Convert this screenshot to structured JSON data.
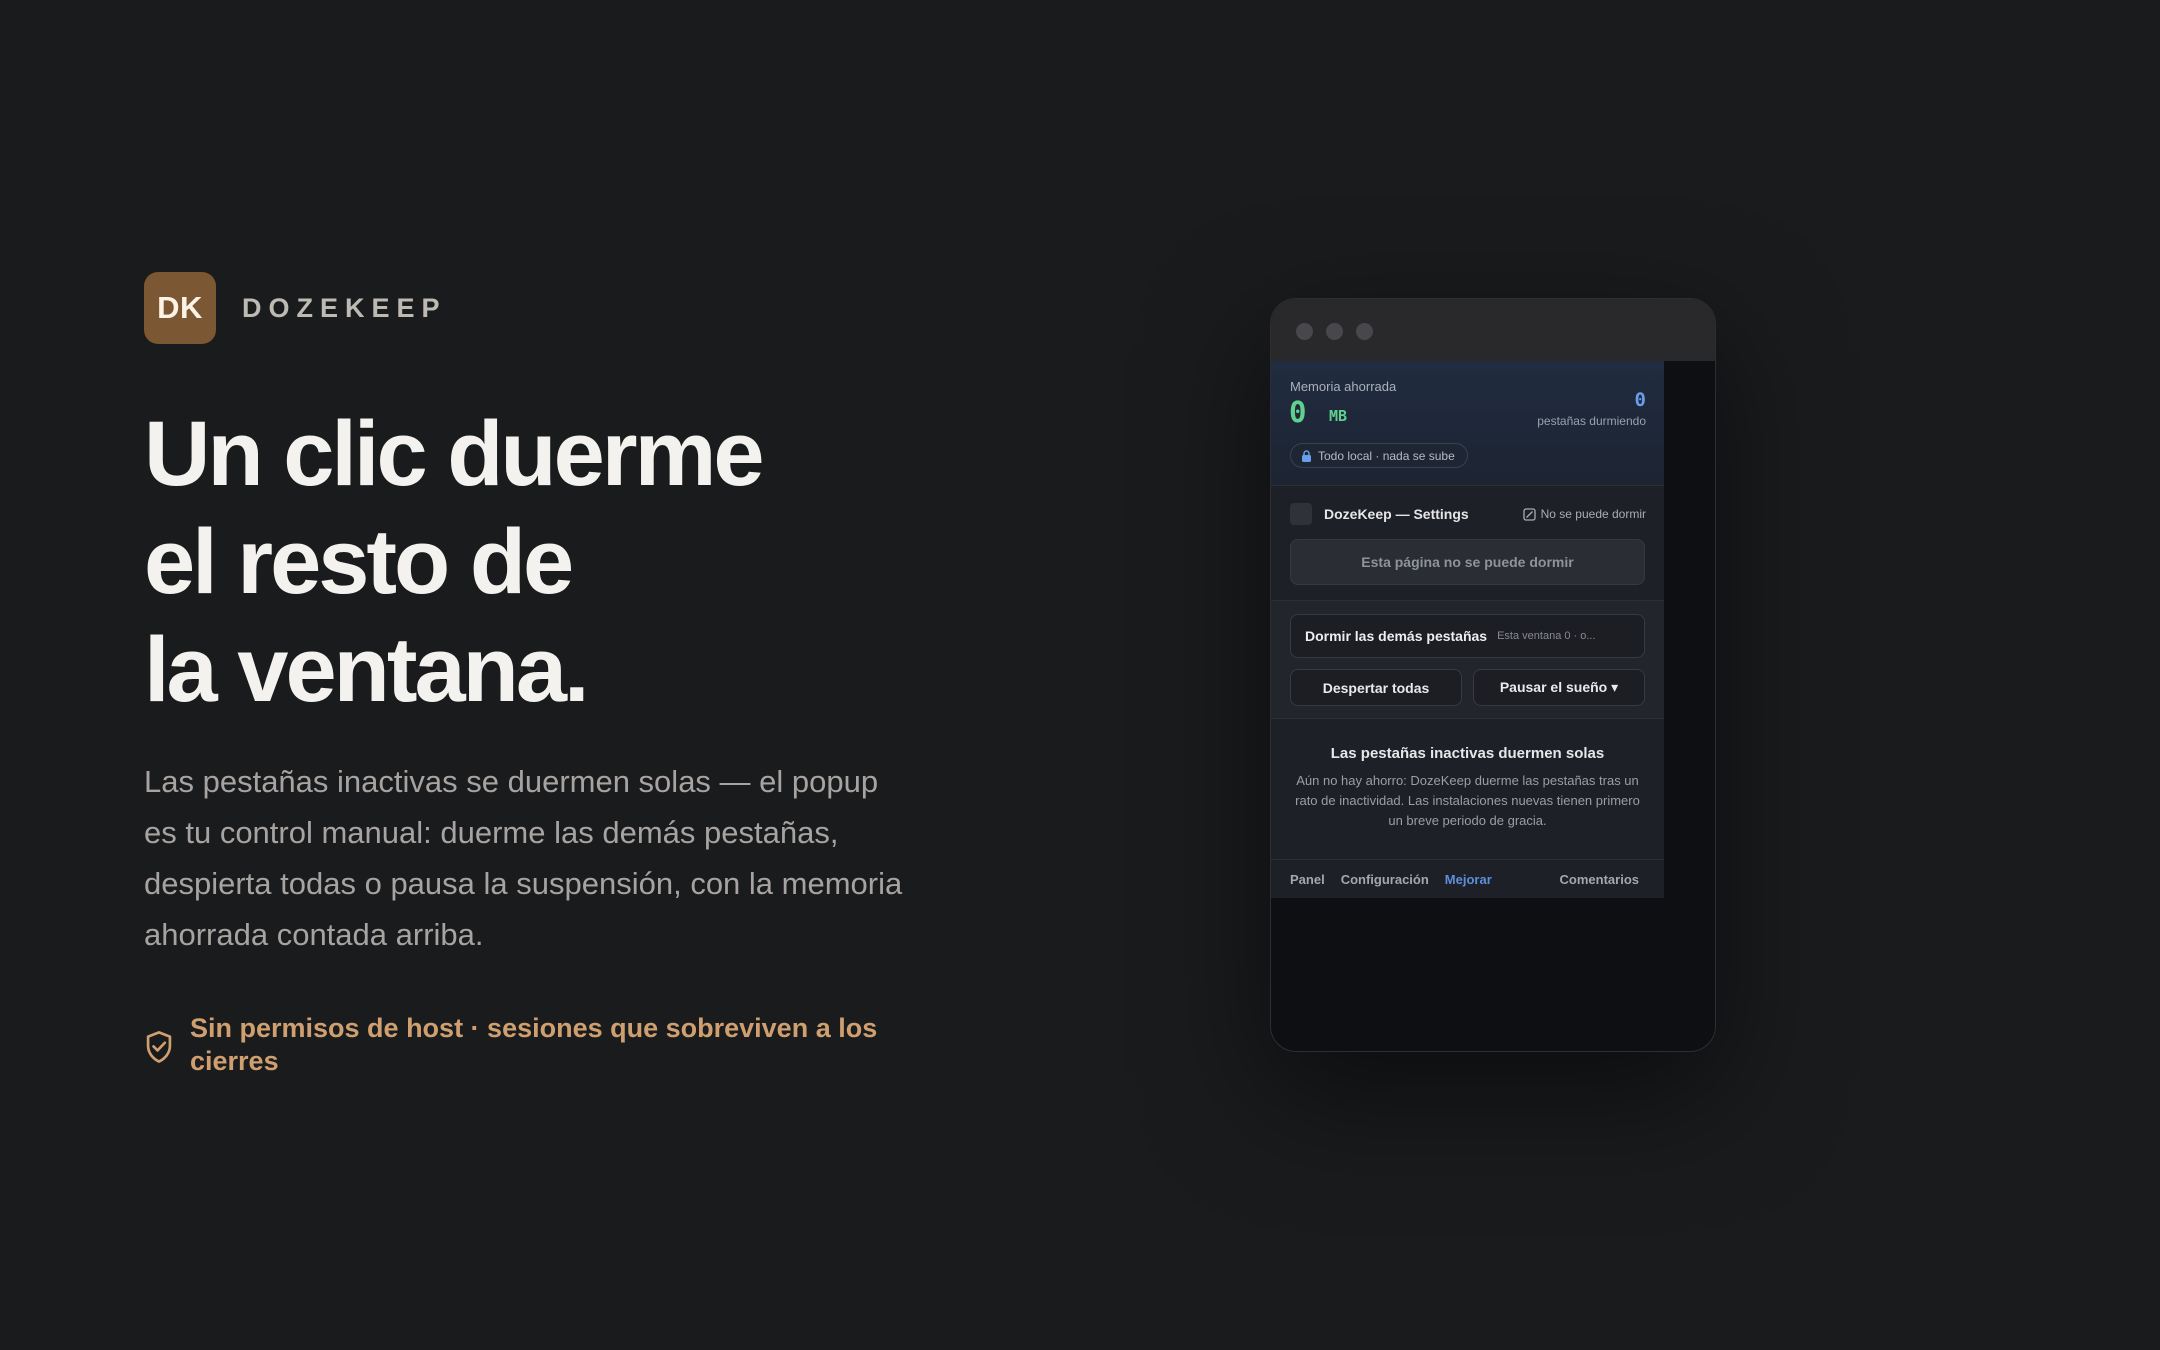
{
  "brand": {
    "logo_text": "DK",
    "name": "DOZEKEEP"
  },
  "hero": {
    "headline": [
      "Un clic duerme",
      "el resto de",
      "la ventana."
    ],
    "lede": "Las pestañas inactivas se duermen solas — el popup es tu control manual: duerme las demás pestañas, despierta todas o pausa la suspensión, con la memoria ahorrada contada arriba.",
    "perks": "Sin permisos de host · sesiones que sobreviven a los cierres"
  },
  "popup": {
    "stats": {
      "memory_label": "Memoria ahorrada",
      "memory_value": "0",
      "memory_unit": "MB",
      "tabs_value": "0",
      "tabs_label": "pestañas durmiendo",
      "privacy_pill": "Todo local · nada se sube"
    },
    "current_tab": {
      "title": "DozeKeep — Settings",
      "status": "No se puede dormir",
      "page_button": "Esta página no se puede dormir"
    },
    "actions": {
      "sleep_others": "Dormir las demás pestañas",
      "sleep_others_sub": "Esta ventana 0 · o...",
      "wake_all": "Despertar todas",
      "pause": "Pausar el sueño ▾"
    },
    "empty_state": {
      "title": "Las pestañas inactivas duermen solas",
      "body": "Aún no hay ahorro: DozeKeep duerme las pestañas tras un rato de inactividad. Las instalaciones nuevas tienen primero un breve periodo de gracia."
    },
    "footer": {
      "panel": "Panel",
      "settings": "Configuración",
      "upgrade": "Mejorar",
      "feedback": "Comentarios"
    }
  },
  "colors": {
    "background": "#1a1b1d",
    "brand": "#7b5733",
    "perk_accent": "#cf9f70",
    "memory_green": "#5fd08e",
    "tabs_blue": "#6a9eea",
    "link_blue": "#5d8fdc"
  }
}
